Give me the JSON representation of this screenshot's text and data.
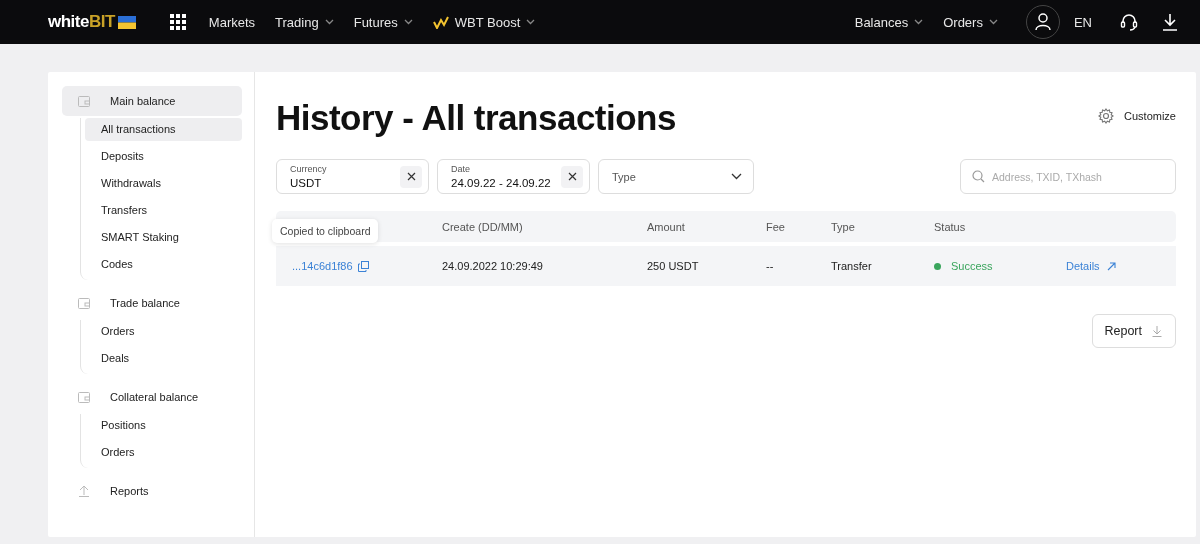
{
  "topbar": {
    "logo": {
      "text": "white",
      "accent": "BIT"
    },
    "nav": [
      {
        "label": "Markets",
        "dropdown": false
      },
      {
        "label": "Trading",
        "dropdown": true
      },
      {
        "label": "Futures",
        "dropdown": true
      },
      {
        "label": "WBT Boost",
        "dropdown": true,
        "kind": "boost"
      }
    ],
    "right_nav": [
      {
        "label": "Balances",
        "dropdown": true
      },
      {
        "label": "Orders",
        "dropdown": true
      }
    ],
    "language": "EN"
  },
  "sidebar": {
    "groups": [
      {
        "label": "Main balance",
        "kind": "wallet",
        "selected": true,
        "children": [
          {
            "label": "All transactions",
            "selected": true
          },
          {
            "label": "Deposits",
            "selected": false
          },
          {
            "label": "Withdrawals",
            "selected": false
          },
          {
            "label": "Transfers",
            "selected": false
          },
          {
            "label": "SMART Staking",
            "selected": false
          },
          {
            "label": "Codes",
            "selected": false
          }
        ]
      },
      {
        "label": "Trade balance",
        "kind": "wallet",
        "selected": false,
        "children": [
          {
            "label": "Orders",
            "selected": false
          },
          {
            "label": "Deals",
            "selected": false
          }
        ]
      },
      {
        "label": "Collateral balance",
        "kind": "wallet",
        "selected": false,
        "children": [
          {
            "label": "Positions",
            "selected": false
          },
          {
            "label": "Orders",
            "selected": false
          }
        ]
      },
      {
        "label": "Reports",
        "kind": "upload",
        "selected": false
      }
    ]
  },
  "page": {
    "title": "History - All transactions",
    "customize": "Customize",
    "filters": [
      {
        "label": "Currency",
        "value": "USDT",
        "kind": "clear"
      },
      {
        "label": "Date",
        "value": "24.09.22 - 24.09.22",
        "kind": "clear"
      },
      {
        "placeholder": "Type",
        "kind": "select"
      }
    ],
    "search": {
      "placeholder": "Address, TXID, TXhash"
    },
    "table": {
      "columns": [
        "",
        "Create (DD/MM)",
        "Amount",
        "Fee",
        "Type",
        "Status"
      ],
      "rows": [
        {
          "txid": "...14c6d1f86",
          "created": "24.09.2022 10:29:49",
          "amount": "250 USDT",
          "fee": "--",
          "type": "Transfer",
          "status": "Success",
          "color": "#3aa55d",
          "details": "Details"
        }
      ]
    },
    "tooltip": "Copied to clipboard",
    "report_button": "Report"
  }
}
